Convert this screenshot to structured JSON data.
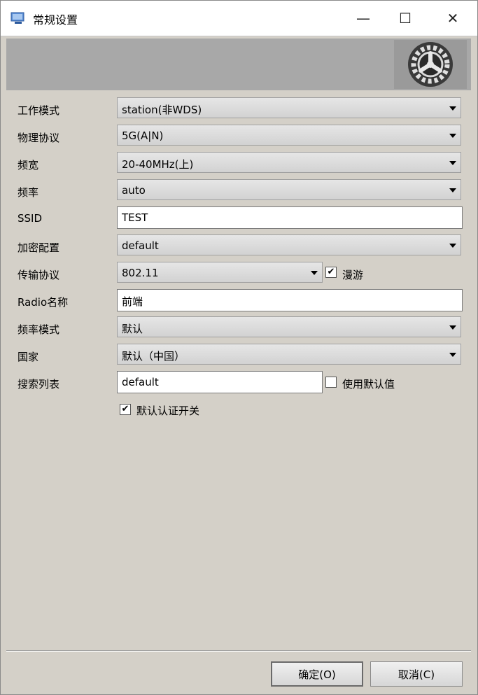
{
  "window": {
    "title": "常规设置",
    "minimize_glyph": "—",
    "maximize_glyph": "☐",
    "close_glyph": "✕"
  },
  "form": {
    "work_mode": {
      "label": "工作模式",
      "value": "station(非WDS)"
    },
    "phy_protocol": {
      "label": "物理协议",
      "value": "5G(A|N)"
    },
    "bandwidth": {
      "label": "频宽",
      "value": "20-40MHz(上)"
    },
    "frequency": {
      "label": "频率",
      "value": "auto"
    },
    "ssid": {
      "label": "SSID",
      "value": "TEST"
    },
    "encryption": {
      "label": "加密配置",
      "value": "default"
    },
    "transport": {
      "label": "传输协议",
      "value": "802.11",
      "roam_label": "漫游",
      "roam_checked": true
    },
    "radio_name": {
      "label": "Radio名称",
      "value": "前端"
    },
    "freq_mode": {
      "label": "频率模式",
      "value": "默认"
    },
    "country": {
      "label": "国家",
      "value": "默认（中国）"
    },
    "scan_list": {
      "label": "搜索列表",
      "value": "default",
      "use_default_label": "使用默认值",
      "use_default_checked": false
    },
    "default_auth": {
      "label": "默认认证开关",
      "checked": true
    }
  },
  "buttons": {
    "ok": "确定(O)",
    "cancel": "取消(C)"
  },
  "check_glyph": "✔",
  "icons": {
    "app": "settings-window-icon",
    "banner": "gear-icon"
  }
}
